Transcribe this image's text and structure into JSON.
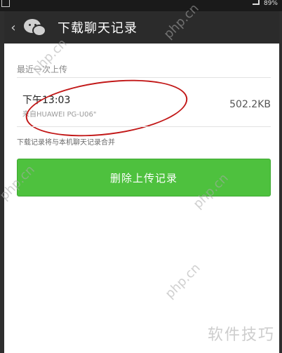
{
  "status_bar": {
    "right_text": "89%"
  },
  "header": {
    "back_glyph": "‹",
    "title": "下载聊天记录"
  },
  "main": {
    "section_label": "最近一次上传",
    "record": {
      "time": "下午13:03",
      "device": "来自HUAWEI PG-U06\"",
      "size": "502.2KB"
    },
    "note": "下载记录将与本机聊天记录合并",
    "delete_button_label": "删除上传记录"
  },
  "watermarks": {
    "text": "php.cn",
    "brand": "软件技巧"
  },
  "colors": {
    "action_bar": "#2b2b2b",
    "button_green": "#4ec13e",
    "annotation_red": "#c21818"
  }
}
